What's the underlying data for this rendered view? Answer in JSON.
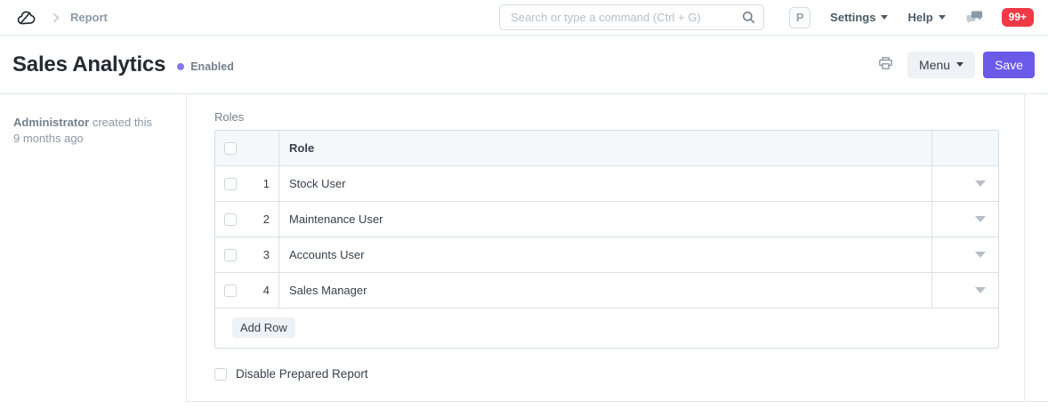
{
  "navbar": {
    "breadcrumb": "Report",
    "search_placeholder": "Search or type a command (Ctrl + G)",
    "avatar_letter": "P",
    "settings_label": "Settings",
    "help_label": "Help",
    "notification_count": "99+"
  },
  "page_header": {
    "title": "Sales Analytics",
    "status_label": "Enabled",
    "menu_label": "Menu",
    "save_label": "Save"
  },
  "sidebar": {
    "created_by": "Administrator",
    "created_text": " created this",
    "created_ago": "9 months ago"
  },
  "main": {
    "section_label": "Roles",
    "table": {
      "column_header": "Role",
      "rows": [
        {
          "index": "1",
          "role": "Stock User"
        },
        {
          "index": "2",
          "role": "Maintenance User"
        },
        {
          "index": "3",
          "role": "Accounts User"
        },
        {
          "index": "4",
          "role": "Sales Manager"
        }
      ],
      "add_row_label": "Add Row"
    },
    "disable_checkbox_label": "Disable Prepared Report"
  },
  "icons": {
    "logo": "cloud-doodle",
    "breadcrumb_chevron": "chevron-right",
    "search": "magnifier",
    "dropdown": "caret-down",
    "notifications": "chat-bubbles",
    "print": "printer",
    "row_expand": "caret-down"
  },
  "colors": {
    "accent_primary": "#6b59e8",
    "status_enabled_dot": "#8577f0",
    "notification_badge": "#ee3a44",
    "table_header_bg": "#f5f8fa",
    "border": "#d4dbe0",
    "text_dark": "#36414c",
    "text_muted": "#8d99a6"
  }
}
